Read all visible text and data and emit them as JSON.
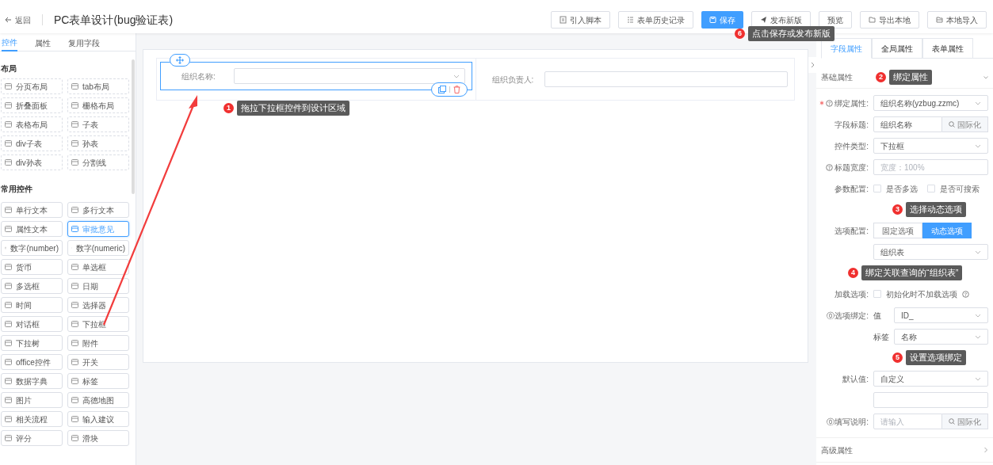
{
  "header": {
    "back": "返回",
    "title": "PC表单设计(bug验证表)",
    "buttons": [
      {
        "label": "引入脚本",
        "kind": "script"
      },
      {
        "label": "表单历史记录",
        "kind": "history"
      },
      {
        "label": "保存",
        "kind": "save"
      },
      {
        "label": "发布新版",
        "kind": "publish"
      },
      {
        "label": "预览",
        "kind": "plain"
      },
      {
        "label": "导出本地",
        "kind": "export"
      },
      {
        "label": "本地导入",
        "kind": "import"
      }
    ]
  },
  "left_tabs": [
    {
      "label": "控件",
      "selected": true
    },
    {
      "label": "属性",
      "selected": false
    },
    {
      "label": "复用字段",
      "selected": false
    }
  ],
  "widget_groups": [
    {
      "title": "布局",
      "items": [
        {
          "label": "分页布局",
          "selected": false
        },
        {
          "label": "tab布局",
          "selected": false
        },
        {
          "label": "折叠面板",
          "selected": false
        },
        {
          "label": "栅格布局",
          "selected": false
        },
        {
          "label": "表格布局",
          "selected": false
        },
        {
          "label": "子表",
          "selected": false
        },
        {
          "label": "div子表",
          "selected": false
        },
        {
          "label": "孙表",
          "selected": false
        },
        {
          "label": "div孙表",
          "selected": false
        },
        {
          "label": "分割线",
          "selected": false
        }
      ]
    },
    {
      "title": "常用控件",
      "items": [
        {
          "label": "单行文本",
          "selected": false
        },
        {
          "label": "多行文本",
          "selected": false
        },
        {
          "label": "属性文本",
          "selected": false
        },
        {
          "label": "审批意见",
          "selected": true
        },
        {
          "label": "数字(number)",
          "selected": false
        },
        {
          "label": "数字(numeric)",
          "selected": false
        },
        {
          "label": "货币",
          "selected": false
        },
        {
          "label": "单选框",
          "selected": false
        },
        {
          "label": "多选框",
          "selected": false
        },
        {
          "label": "日期",
          "selected": false
        },
        {
          "label": "时间",
          "selected": false
        },
        {
          "label": "选择器",
          "selected": false
        },
        {
          "label": "对话框",
          "selected": false
        },
        {
          "label": "下拉框",
          "selected": false
        },
        {
          "label": "下拉树",
          "selected": false
        },
        {
          "label": "附件",
          "selected": false
        },
        {
          "label": "office控件",
          "selected": false
        },
        {
          "label": "开关",
          "selected": false
        },
        {
          "label": "数据字典",
          "selected": false
        },
        {
          "label": "标签",
          "selected": false
        },
        {
          "label": "图片",
          "selected": false
        },
        {
          "label": "高德地图",
          "selected": false
        },
        {
          "label": "相关流程",
          "selected": false
        },
        {
          "label": "输入建议",
          "selected": false
        },
        {
          "label": "评分",
          "selected": false
        },
        {
          "label": "滑块",
          "selected": false
        }
      ]
    }
  ],
  "canvas_fields": [
    {
      "label": "组织名称:",
      "kind": "select",
      "selected": true
    },
    {
      "label": "组织负责人:",
      "kind": "input",
      "selected": false
    }
  ],
  "right_tabs": [
    {
      "label": "字段属性",
      "selected": true
    },
    {
      "label": "全局属性",
      "selected": false
    },
    {
      "label": "表单属性",
      "selected": false
    }
  ],
  "basic_section": {
    "title": "基础属性",
    "expanded": true
  },
  "props": [
    {
      "kind": "select",
      "label": "绑定属性:",
      "required": true,
      "help": true,
      "value": "组织名称(yzbug.zzmc)"
    },
    {
      "kind": "i18n",
      "label": "字段标题:",
      "value": "组织名称",
      "button": "国际化"
    },
    {
      "kind": "select",
      "label": "控件类型:",
      "value": "下拉框"
    },
    {
      "kind": "input",
      "label": "标题宽度:",
      "help": true,
      "placeholder": "宽度：100%"
    },
    {
      "kind": "checks",
      "label": "参数配置:",
      "options": [
        {
          "label": "是否多选",
          "checked": false
        },
        {
          "label": "是否可搜索",
          "checked": false
        }
      ]
    },
    {
      "kind": "segmented",
      "label": "选项配置:",
      "options": [
        {
          "label": "固定选项",
          "selected": false
        },
        {
          "label": "动态选项",
          "selected": true
        }
      ]
    },
    {
      "kind": "select",
      "value": "组织表"
    },
    {
      "kind": "checks",
      "label": "加载选项:",
      "help_after": true,
      "options": [
        {
          "label": "初始化时不加载选项",
          "checked": false
        }
      ]
    },
    {
      "kind": "bind",
      "label": "⓪选项绑定:",
      "prefix": "值",
      "value": "ID_"
    },
    {
      "kind": "bind",
      "prefix": "标签",
      "value": "名称"
    },
    {
      "kind": "select",
      "label": "默认值:",
      "value": "自定义"
    },
    {
      "kind": "input"
    },
    {
      "kind": "i18n",
      "label": "⓪填写说明:",
      "placeholder": "请输入",
      "button": "国际化"
    }
  ],
  "advanced_section": {
    "title": "高级属性",
    "expanded": false
  },
  "annotations": [
    {
      "number": "1",
      "text": "拖拉下拉框控件到设计区域"
    },
    {
      "number": "2",
      "text": "绑定属性"
    },
    {
      "number": "3",
      "text": "选择动态选项"
    },
    {
      "number": "4",
      "text": "绑定关联查询的“组织表”"
    },
    {
      "number": "5",
      "text": "设置选项绑定"
    },
    {
      "number": "6",
      "text": "点击保存或发布新版"
    }
  ]
}
